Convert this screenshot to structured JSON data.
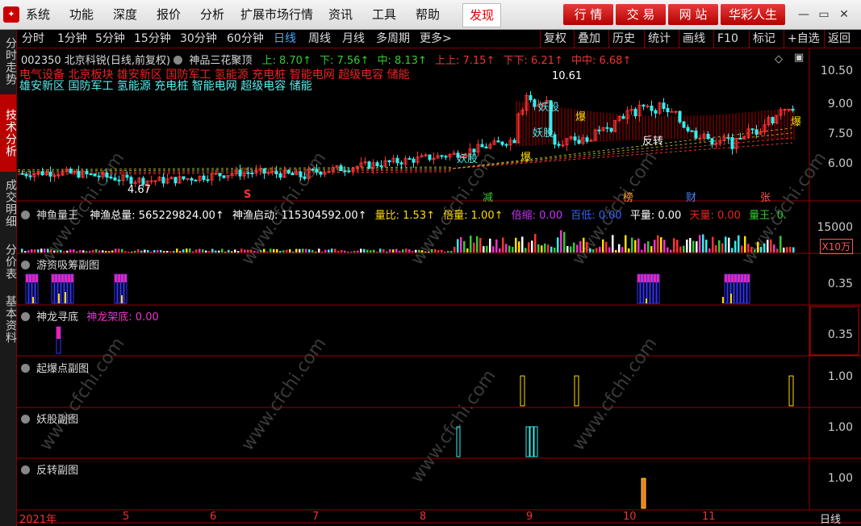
{
  "menu": {
    "items": [
      "系统",
      "功能",
      "深度",
      "报价",
      "分析",
      "扩展市场行情",
      "资讯",
      "工具",
      "帮助"
    ],
    "discover": "发现",
    "nav": [
      "行 情",
      "交 易",
      "网 站",
      "华彩人生"
    ]
  },
  "sidebar": {
    "tabs": [
      "分时走势",
      "技术分析",
      "成交明细",
      "分价表",
      "基本资料"
    ]
  },
  "periods": [
    "分时",
    "1分钟",
    "5分钟",
    "15分钟",
    "30分钟",
    "60分钟",
    "日线",
    "周线",
    "月线",
    "多周期",
    "更多>"
  ],
  "tools": [
    "复权",
    "叠加",
    "历史",
    "统计",
    "画线",
    "F10",
    "标记",
    "+自选",
    "返回"
  ],
  "main": {
    "stock": "002350 北京科锐(日线,前复权)",
    "indicator": "神品三花聚顶",
    "up": "上: 8.70↑",
    "down": "下: 7.56↑",
    "mid": "中: 8.13↑",
    "up_up": "上上: 7.15↑",
    "down_down": "下下: 6.21↑",
    "mid_mid": "中中: 6.68↑",
    "concepts_red": "电气设备 北京板块 雄安新区 国防军工 氢能源 充电桩 智能电网 超级电容 储能",
    "concepts_cyan": "雄安新区 国防军工 氢能源 充电桩 智能电网 超级电容 储能",
    "high_label": "10.61",
    "low_label": "4.67",
    "y_ticks": [
      "10.50",
      "9.00",
      "7.50",
      "6.00"
    ],
    "markers": [
      {
        "t": "S",
        "c": "#f33"
      },
      {
        "t": "减",
        "c": "#3c3"
      },
      {
        "t": "榜",
        "c": "#e93"
      },
      {
        "t": "财",
        "c": "#48f"
      },
      {
        "t": "张",
        "c": "#f55"
      }
    ],
    "chart_texts": [
      {
        "t": "妖股",
        "c": "#5ee"
      },
      {
        "t": "妖股",
        "c": "#5ee"
      },
      {
        "t": "爆",
        "c": "#fd0"
      },
      {
        "t": "爆",
        "c": "#fd0"
      },
      {
        "t": "反转",
        "c": "#fff"
      },
      {
        "t": "爆",
        "c": "#fd0"
      },
      {
        "t": "妖股",
        "c": "#5ee"
      }
    ]
  },
  "volume": {
    "name": "神鱼量王",
    "total": "神渔总量: 565229824.00↑",
    "start": "神渔启动: 115304592.00↑",
    "ratio": "量比: 1.53↑",
    "multi": "倍量: 1.00↑",
    "shrink": "倍缩: 0.00",
    "hundred_low": "百低: 0.00",
    "flat": "平量: 0.00",
    "sky": "天量: 0.00",
    "king": "量王: 0.",
    "y_tick": "15000",
    "unit": "X10万"
  },
  "sub1": {
    "name": "游资吸筹副图",
    "tick": "0.35"
  },
  "sub2": {
    "name": "神龙寻底",
    "value": "神龙架底: 0.00",
    "tick": "0.35"
  },
  "sub3": {
    "name": "起爆点副图",
    "tick": "1.00"
  },
  "sub4": {
    "name": "妖股副图",
    "tick": "1.00"
  },
  "sub5": {
    "name": "反转副图",
    "tick": "1.00"
  },
  "xaxis": {
    "labels": [
      "2021年",
      "5",
      "6",
      "7",
      "8",
      "9",
      "10",
      "11"
    ],
    "period": "日线"
  },
  "watermark": "www.cfchi.com"
}
